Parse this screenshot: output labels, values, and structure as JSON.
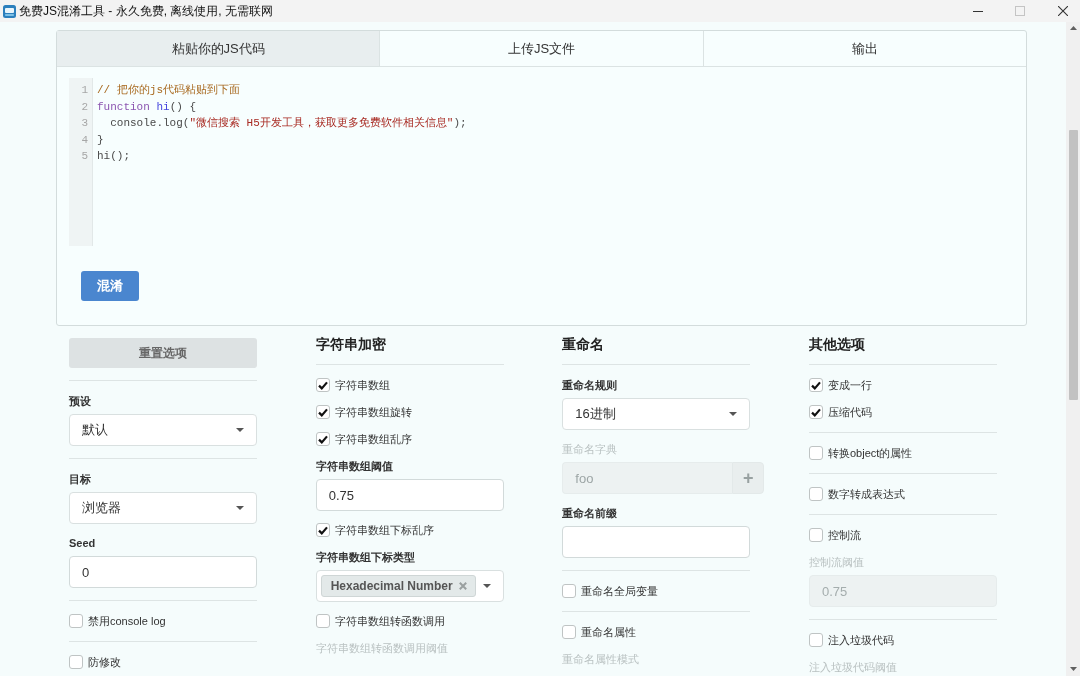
{
  "window": {
    "title": "免费JS混淆工具 - 永久免费, 离线使用, 无需联网"
  },
  "tabs": [
    {
      "label": "粘贴你的JS代码",
      "selected": true
    },
    {
      "label": "上传JS文件",
      "selected": false
    },
    {
      "label": "输出",
      "selected": false
    }
  ],
  "editor": {
    "lines": [
      {
        "number": "1",
        "tokens": [
          {
            "kind": "comment",
            "text": "// 把你的js代码粘贴到下面"
          }
        ]
      },
      {
        "number": "2",
        "tokens": [
          {
            "kind": "keyword",
            "text": "function "
          },
          {
            "kind": "def",
            "text": "hi"
          },
          {
            "kind": "plain",
            "text": "() {"
          }
        ]
      },
      {
        "number": "3",
        "tokens": [
          {
            "kind": "plain",
            "text": "  console.log("
          },
          {
            "kind": "string",
            "text": "\"微信搜索 H5开发工具，获取更多免费软件相关信息\""
          },
          {
            "kind": "plain",
            "text": ");"
          }
        ]
      },
      {
        "number": "4",
        "tokens": [
          {
            "kind": "plain",
            "text": "}"
          }
        ]
      },
      {
        "number": "5",
        "tokens": [
          {
            "kind": "plain",
            "text": "hi();"
          }
        ]
      }
    ]
  },
  "obfuscate_button": "混淆",
  "options": {
    "columns": [
      {
        "sections": [
          [
            {
              "kind": "button",
              "label": "重置选项"
            }
          ],
          [
            {
              "kind": "select",
              "label": "预设",
              "value": "默认"
            }
          ],
          [
            {
              "kind": "select",
              "label": "目标",
              "value": "浏览器"
            },
            {
              "kind": "input",
              "label": "Seed",
              "value": "0",
              "disabled": false
            }
          ],
          [
            {
              "kind": "checkbox",
              "label": "禁用console log",
              "checked": false
            }
          ],
          [
            {
              "kind": "checkbox",
              "label": "防修改",
              "checked": false
            }
          ]
        ]
      },
      {
        "heading": "字符串加密",
        "sections": [
          [
            {
              "kind": "checkbox",
              "label": "字符串数组",
              "checked": true
            },
            {
              "kind": "checkbox",
              "label": "字符串数组旋转",
              "checked": true
            },
            {
              "kind": "checkbox",
              "label": "字符串数组乱序",
              "checked": true
            },
            {
              "kind": "input",
              "label": "字符串数组阈值",
              "value": "0.75",
              "disabled": false
            },
            {
              "kind": "checkbox",
              "label": "字符串数组下标乱序",
              "checked": true
            },
            {
              "kind": "tags",
              "label": "字符串数组下标类型",
              "tags": [
                "Hexadecimal Number"
              ]
            },
            {
              "kind": "checkbox",
              "label": "字符串数组转函数调用",
              "checked": false
            },
            {
              "kind": "label",
              "label": "字符串数组转函数调用阈值",
              "disabled": true
            }
          ]
        ]
      },
      {
        "heading": "重命名",
        "sections": [
          [
            {
              "kind": "select",
              "label": "重命名规则",
              "value": "16进制"
            },
            {
              "kind": "input_group",
              "label": "重命名字典",
              "placeholder": "foo",
              "button": "+",
              "disabled": true
            },
            {
              "kind": "input",
              "label": "重命名前缀",
              "disabled": false
            }
          ],
          [
            {
              "kind": "checkbox",
              "label": "重命名全局变量",
              "checked": false
            }
          ],
          [
            {
              "kind": "checkbox",
              "label": "重命名属性",
              "checked": false
            },
            {
              "kind": "label",
              "label": "重命名属性模式",
              "disabled": true
            }
          ]
        ]
      },
      {
        "heading": "其他选项",
        "sections": [
          [
            {
              "kind": "checkbox",
              "label": "变成一行",
              "checked": true
            },
            {
              "kind": "checkbox",
              "label": "压缩代码",
              "checked": true
            }
          ],
          [
            {
              "kind": "checkbox",
              "label": "转换object的属性",
              "checked": false
            }
          ],
          [
            {
              "kind": "checkbox",
              "label": "数字转成表达式",
              "checked": false
            }
          ],
          [
            {
              "kind": "checkbox",
              "label": "控制流",
              "checked": false
            },
            {
              "kind": "input",
              "label": "控制流阈值",
              "value": "0.75",
              "disabled": true
            }
          ],
          [
            {
              "kind": "checkbox",
              "label": "注入垃圾代码",
              "checked": false
            },
            {
              "kind": "label",
              "label": "注入垃圾代码阈值",
              "disabled": true
            }
          ]
        ]
      }
    ]
  }
}
